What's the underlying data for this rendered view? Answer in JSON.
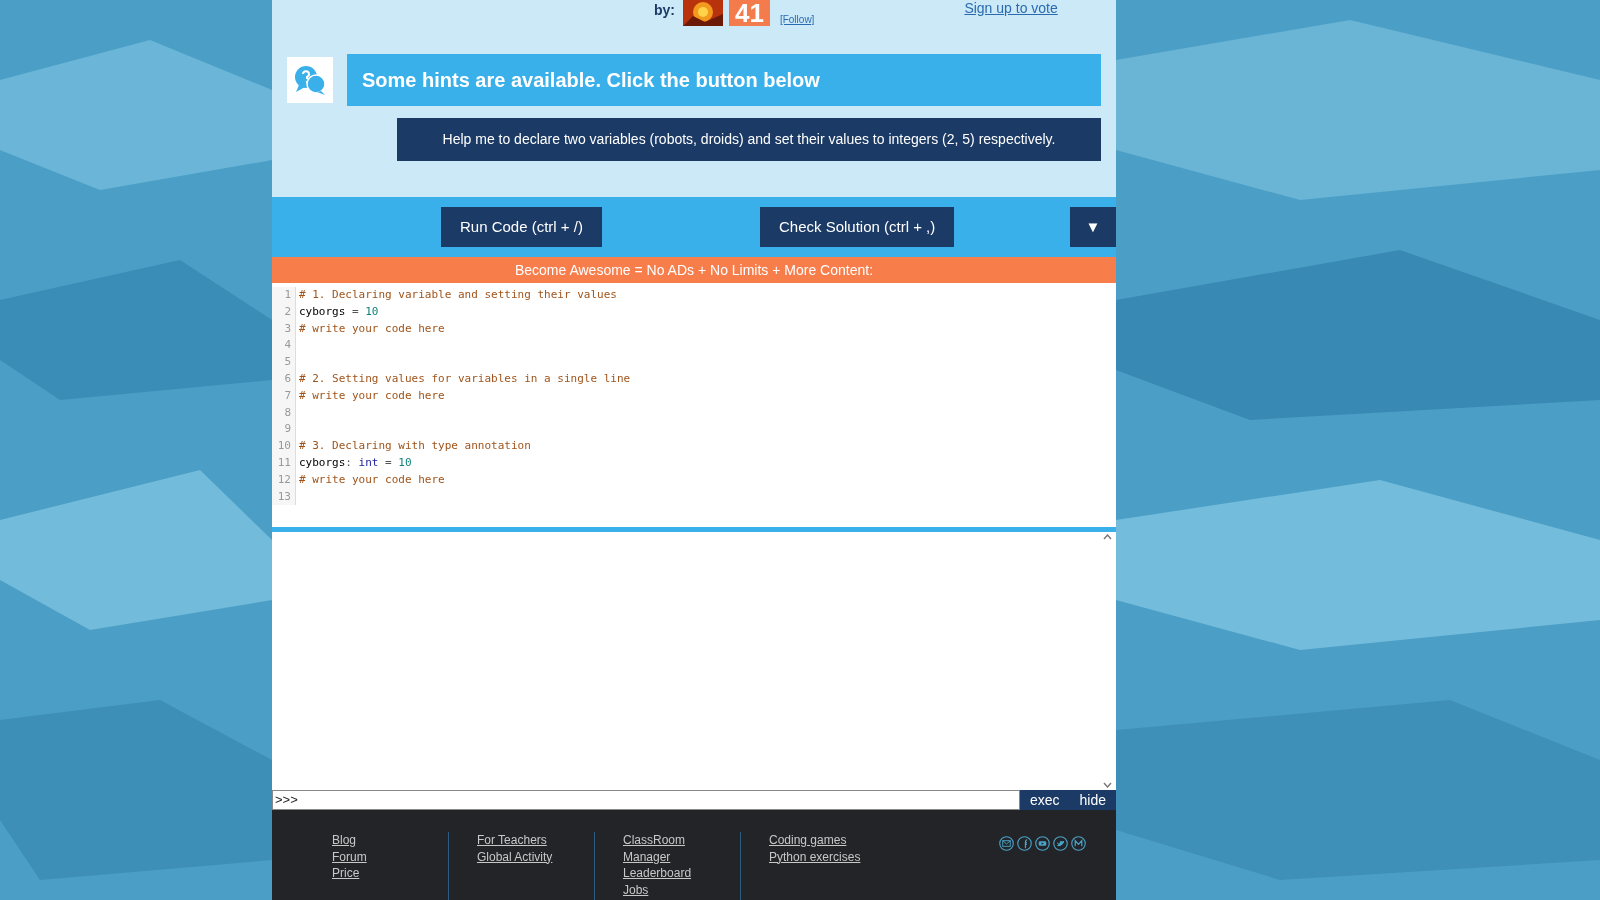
{
  "header": {
    "by_label": "by:",
    "score": "41",
    "follow_link": "[Follow]",
    "vote_link": "Sign up to vote"
  },
  "hints": {
    "banner": "Some hints are available. Click the button below",
    "hint_button": "Help me to declare two variables (robots, droids) and set their values to integers (2, 5) respectively."
  },
  "toolbar": {
    "buttons": [
      "Run Code (ctrl + /)",
      "Check Solution (ctrl + ,)"
    ],
    "menu_button": "▼"
  },
  "promo_bar": "Become Awesome = No ADs + No Limits + More Content:",
  "editor": {
    "lines": [
      {
        "number": "1",
        "tokens": [
          {
            "text": "# 1. Declaring variable and setting their values",
            "kind": "comment"
          }
        ]
      },
      {
        "number": "2",
        "tokens": [
          {
            "text": "cyborgs",
            "kind": "name"
          },
          {
            "text": " = ",
            "kind": "op"
          },
          {
            "text": "10",
            "kind": "number"
          }
        ]
      },
      {
        "number": "3",
        "tokens": [
          {
            "text": "# write your code here",
            "kind": "comment"
          }
        ]
      },
      {
        "number": "4"
      },
      {
        "number": "5"
      },
      {
        "number": "6",
        "tokens": [
          {
            "text": "# 2. Setting values for variables in a single line",
            "kind": "comment"
          }
        ]
      },
      {
        "number": "7",
        "tokens": [
          {
            "text": "# write your code here",
            "kind": "comment"
          }
        ]
      },
      {
        "number": "8"
      },
      {
        "number": "9"
      },
      {
        "number": "10",
        "tokens": [
          {
            "text": "# 3. Declaring with type annotation",
            "kind": "comment"
          }
        ]
      },
      {
        "number": "11",
        "tokens": [
          {
            "text": "cyborgs",
            "kind": "name"
          },
          {
            "text": ": ",
            "kind": "op"
          },
          {
            "text": "int",
            "kind": "keyword"
          },
          {
            "text": " = ",
            "kind": "op"
          },
          {
            "text": "10",
            "kind": "number"
          }
        ]
      },
      {
        "number": "12",
        "tokens": [
          {
            "text": "# write your code here",
            "kind": "comment"
          }
        ]
      },
      {
        "number": "13"
      }
    ]
  },
  "console": {
    "prompt": ">>>",
    "buttons": [
      "exec",
      "hide"
    ]
  },
  "footer": {
    "columns": [
      [
        "Blog",
        "Forum",
        "Price"
      ],
      [
        "For Teachers",
        "Global Activity"
      ],
      [
        "ClassRoom Manager",
        "Leaderboard",
        "Jobs"
      ],
      [
        "Coding games",
        "Python exercises"
      ]
    ]
  }
}
